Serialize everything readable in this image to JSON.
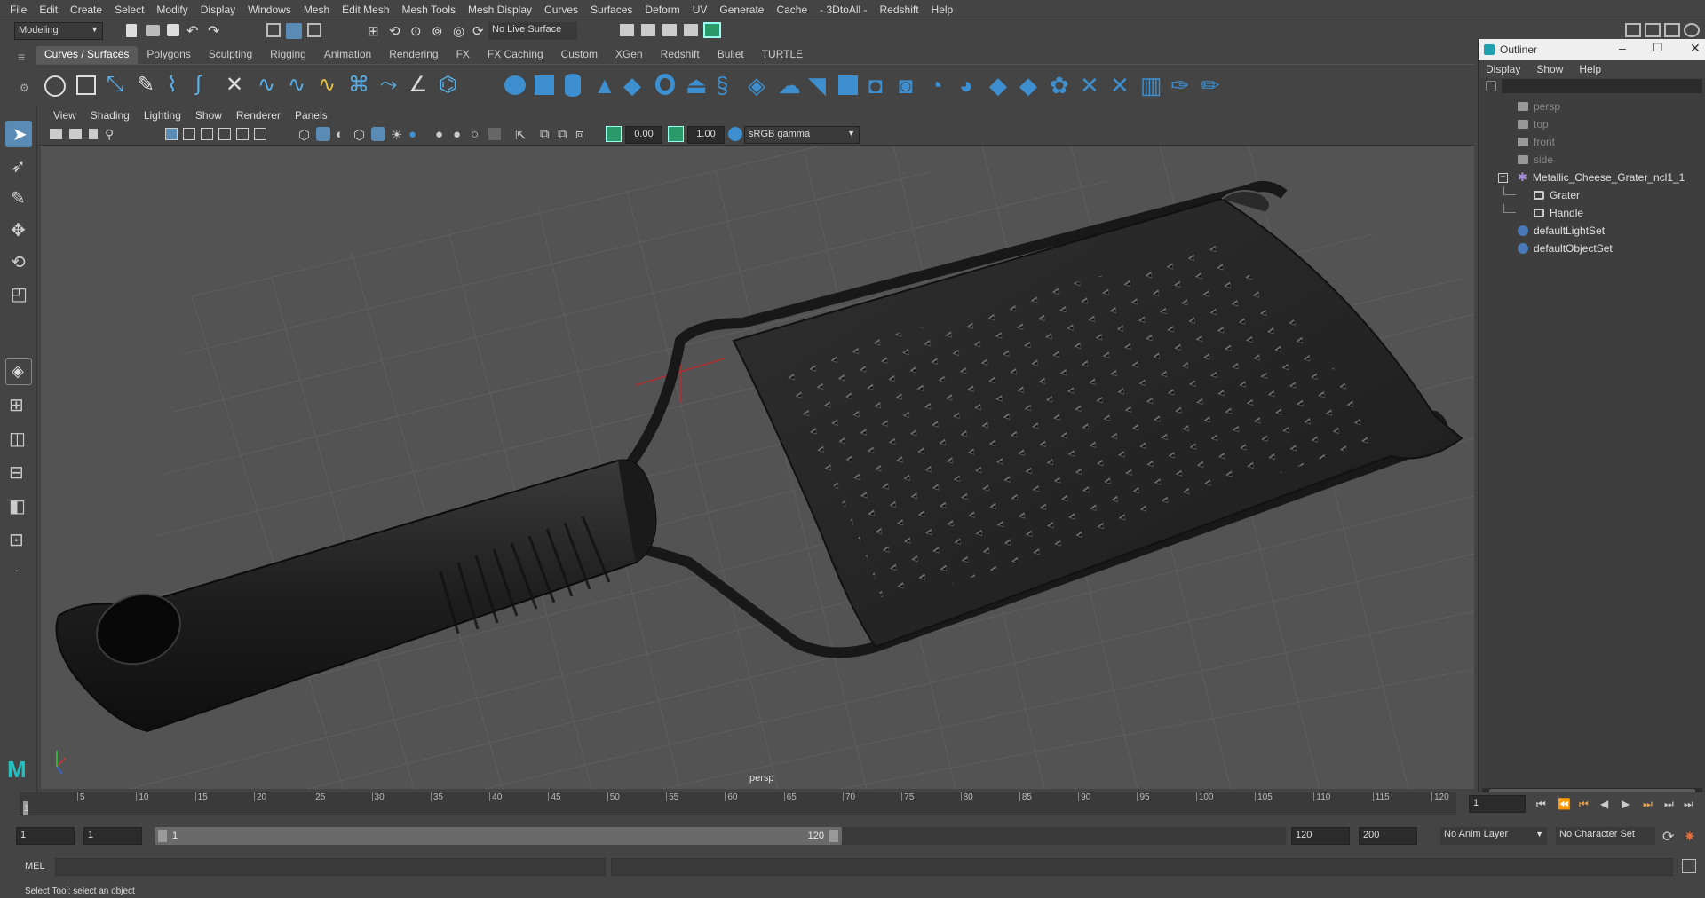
{
  "menubar": {
    "items": [
      "File",
      "Edit",
      "Create",
      "Select",
      "Modify",
      "Display",
      "Windows",
      "Mesh",
      "Edit Mesh",
      "Mesh Tools",
      "Mesh Display",
      "Curves",
      "Surfaces",
      "Deform",
      "UV",
      "Generate",
      "Cache",
      "- 3DtoAll -",
      "Redshift",
      "Help"
    ]
  },
  "statusline": {
    "mode": "Modeling",
    "live_surface": "No Live Surface"
  },
  "shelf": {
    "tabs": [
      "Curves / Surfaces",
      "Polygons",
      "Sculpting",
      "Rigging",
      "Animation",
      "Rendering",
      "FX",
      "FX Caching",
      "Custom",
      "XGen",
      "Redshift",
      "Bullet",
      "TURTLE"
    ],
    "active": "Curves / Surfaces"
  },
  "viewport": {
    "menu": [
      "View",
      "Shading",
      "Lighting",
      "Show",
      "Renderer",
      "Panels"
    ],
    "exposure": "0.00",
    "gamma": "1.00",
    "color_space": "sRGB gamma",
    "camera_label": "persp"
  },
  "outliner": {
    "title": "Outliner",
    "menu": [
      "Display",
      "Show",
      "Help"
    ],
    "items": [
      {
        "label": "persp",
        "icon": "camera-icon",
        "indent": 0,
        "dim": true
      },
      {
        "label": "top",
        "icon": "camera-icon",
        "indent": 0,
        "dim": true
      },
      {
        "label": "front",
        "icon": "camera-icon",
        "indent": 0,
        "dim": true
      },
      {
        "label": "side",
        "icon": "camera-icon",
        "indent": 0,
        "dim": true
      },
      {
        "label": "Metallic_Cheese_Grater_ncl1_1",
        "icon": "group-icon",
        "indent": 0,
        "dim": false,
        "expanded": true
      },
      {
        "label": "Grater",
        "icon": "mesh-icon",
        "indent": 1,
        "dim": false
      },
      {
        "label": "Handle",
        "icon": "mesh-icon",
        "indent": 1,
        "dim": false
      },
      {
        "label": "defaultLightSet",
        "icon": "set-icon",
        "indent": 0,
        "dim": false
      },
      {
        "label": "defaultObjectSet",
        "icon": "set-icon",
        "indent": 0,
        "dim": false
      }
    ]
  },
  "timeline": {
    "ticks": [
      "5",
      "10",
      "15",
      "20",
      "25",
      "30",
      "35",
      "40",
      "45",
      "50",
      "55",
      "60",
      "65",
      "70",
      "75",
      "80",
      "85",
      "90",
      "95",
      "100",
      "105",
      "110",
      "115",
      "120"
    ],
    "start_tick": "1",
    "current_frame": "1"
  },
  "range": {
    "start": "1",
    "playback_start": "1",
    "slider_start": "1",
    "slider_end": "120",
    "playback_end": "120",
    "end": "200",
    "anim_layer": "No Anim Layer",
    "character_set": "No Character Set"
  },
  "mel": {
    "label": "MEL"
  },
  "help": {
    "text": "Select Tool: select an object"
  }
}
